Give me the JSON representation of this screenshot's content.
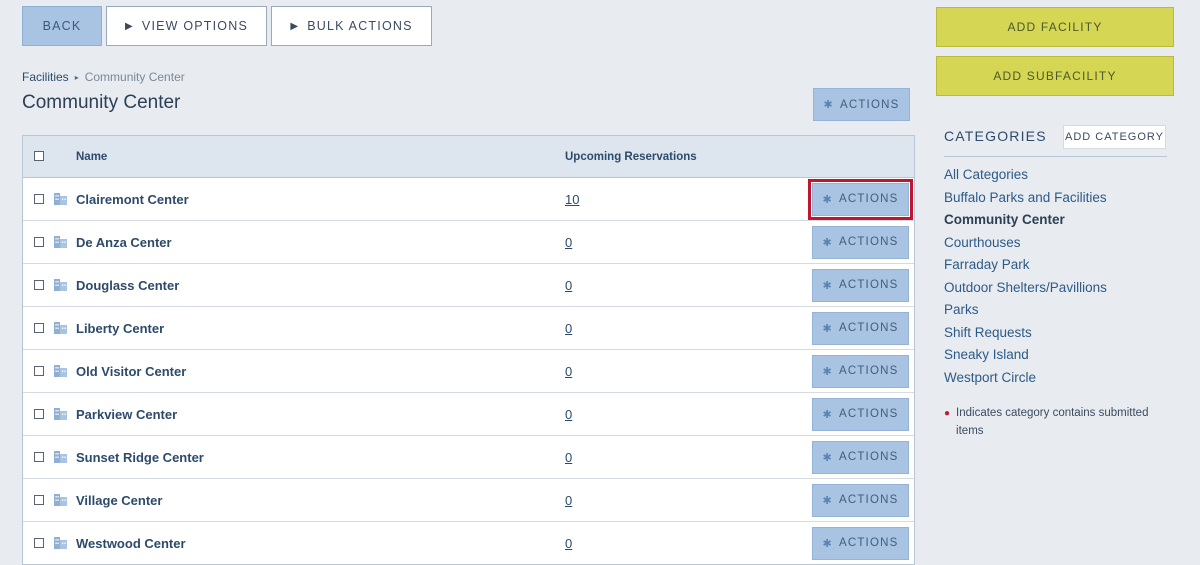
{
  "toolbar": {
    "back_label": "BACK",
    "view_options_label": "VIEW OPTIONS",
    "bulk_actions_label": "BULK ACTIONS"
  },
  "breadcrumb": {
    "root": "Facilities",
    "current": "Community Center"
  },
  "page_title": "Community Center",
  "actions_label": "ACTIONS",
  "table": {
    "columns": [
      "Name",
      "Upcoming Reservations"
    ],
    "rows": [
      {
        "name": "Clairemont Center",
        "count": "10"
      },
      {
        "name": "De Anza Center",
        "count": "0"
      },
      {
        "name": "Douglass Center",
        "count": "0"
      },
      {
        "name": "Liberty Center",
        "count": "0"
      },
      {
        "name": "Old Visitor Center",
        "count": "0"
      },
      {
        "name": "Parkview Center",
        "count": "0"
      },
      {
        "name": "Sunset Ridge Center",
        "count": "0"
      },
      {
        "name": "Village Center",
        "count": "0"
      },
      {
        "name": "Westwood Center",
        "count": "0"
      }
    ]
  },
  "sidebar": {
    "add_facility_label": "ADD FACILITY",
    "add_subfacility_label": "ADD SUBFACILITY",
    "categories_heading": "CATEGORIES",
    "add_category_label": "ADD CATEGORY",
    "categories": [
      "All Categories",
      "Buffalo Parks and Facilities",
      "Community Center",
      "Courthouses",
      "Farraday Park",
      "Outdoor Shelters/Pavillions",
      "Parks",
      "Shift Requests",
      "Sneaky Island",
      "Westport Circle"
    ],
    "active_category": "Community Center",
    "legend_text": "Indicates category contains submitted items"
  },
  "colors": {
    "accent_blue": "#a9c4e2",
    "accent_yellow": "#d4d654",
    "highlight_red": "#c0152e"
  }
}
